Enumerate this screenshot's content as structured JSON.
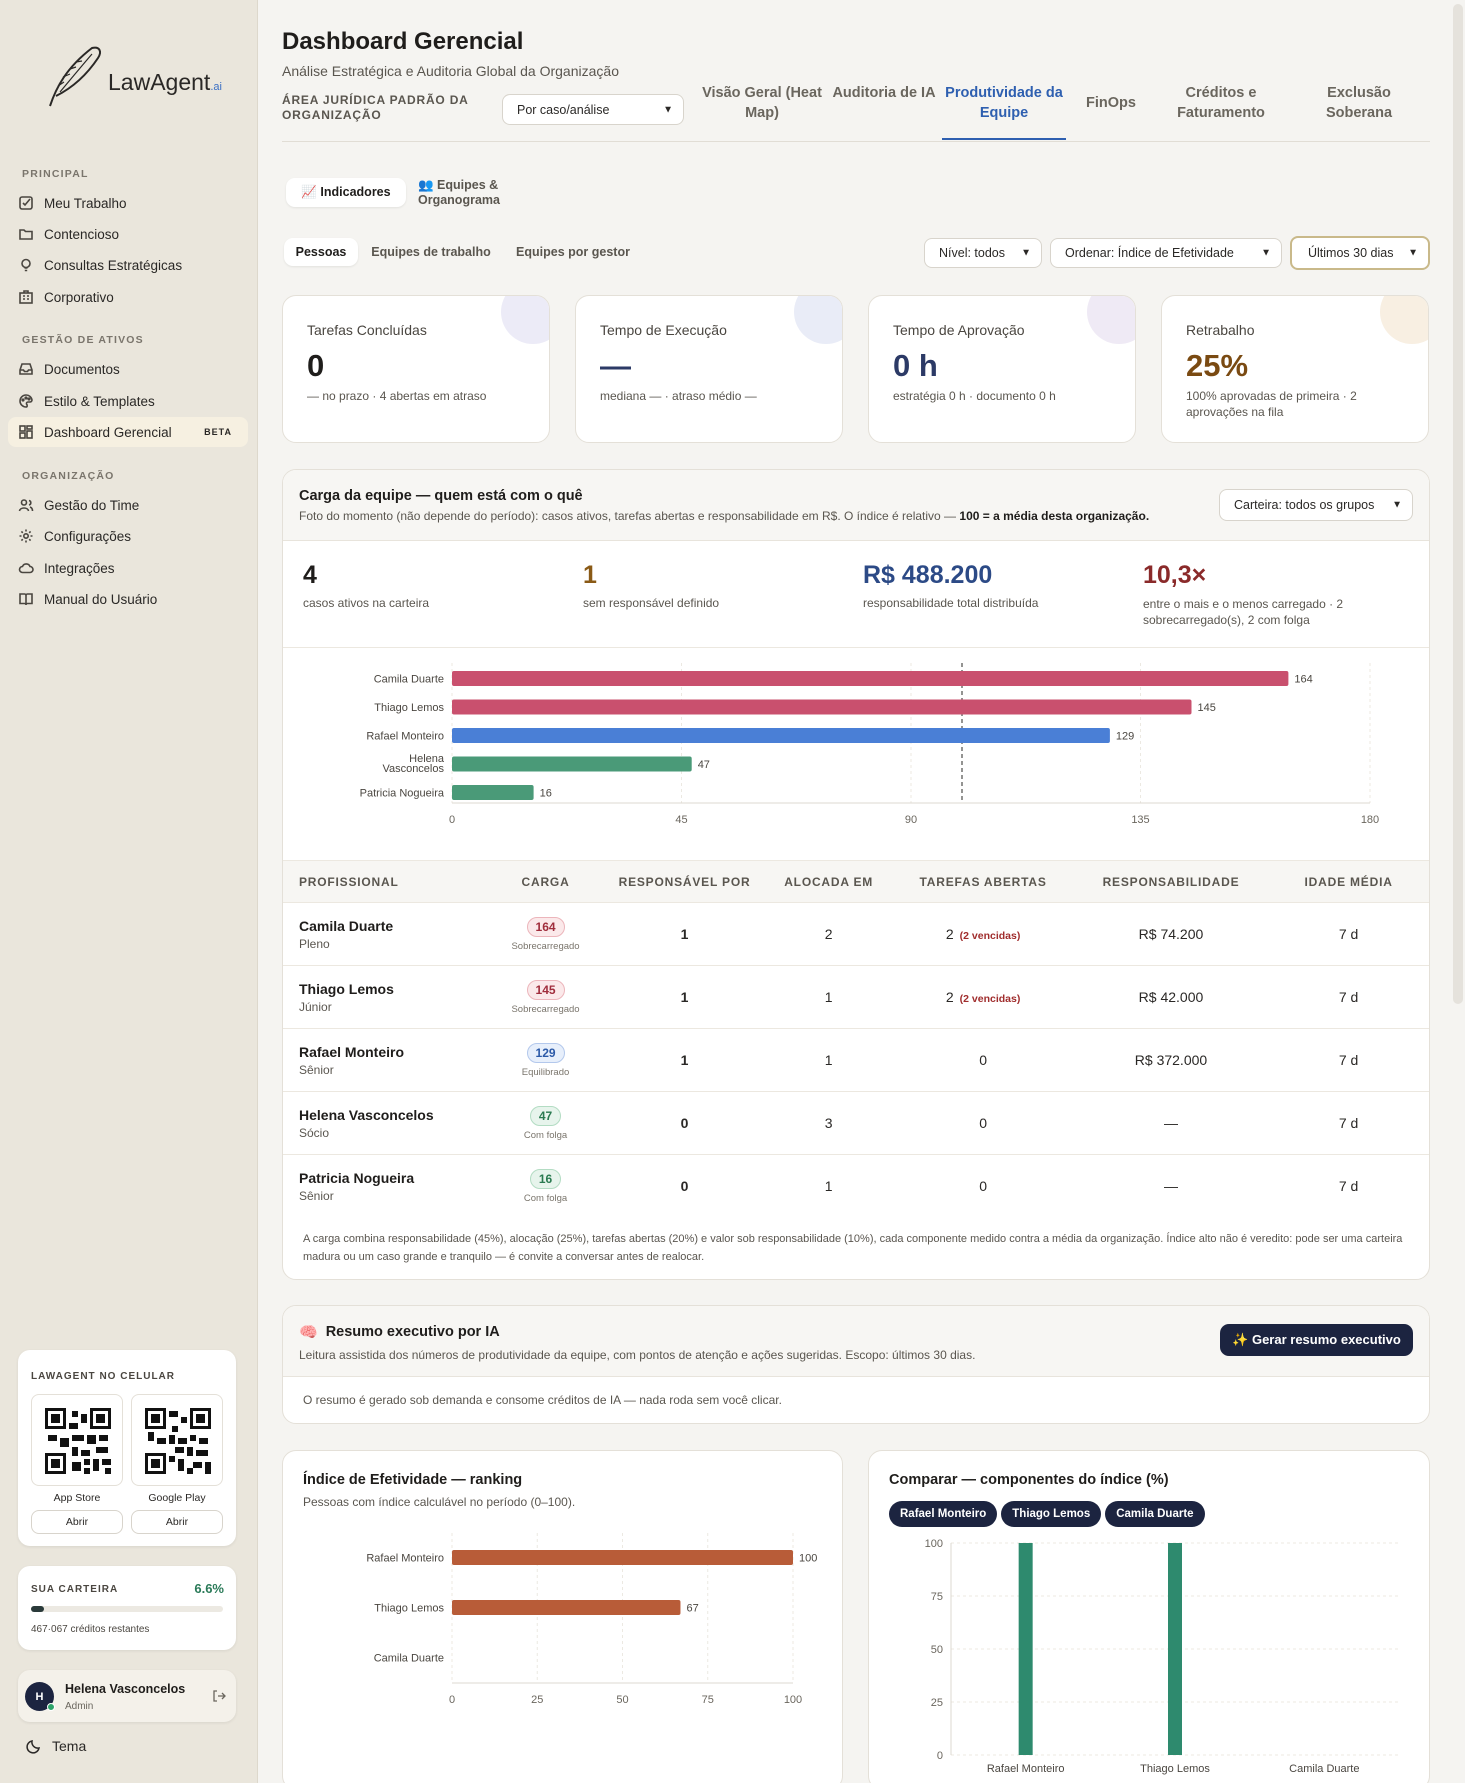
{
  "brand": {
    "name": "LawAgent",
    "suffix": ".ai"
  },
  "sidebar": {
    "sections": [
      {
        "title": "PRINCIPAL",
        "items": [
          {
            "label": "Meu Trabalho",
            "icon": "checkbox-icon"
          },
          {
            "label": "Contencioso",
            "icon": "folder-icon"
          },
          {
            "label": "Consultas Estratégicas",
            "icon": "lightbulb-icon"
          },
          {
            "label": "Corporativo",
            "icon": "building-icon"
          }
        ]
      },
      {
        "title": "GESTÃO DE ATIVOS",
        "items": [
          {
            "label": "Documentos",
            "icon": "inbox-icon"
          },
          {
            "label": "Estilo & Templates",
            "icon": "palette-icon"
          },
          {
            "label": "Dashboard Gerencial",
            "icon": "dashboard-icon",
            "badge": "BETA",
            "active": true
          }
        ]
      },
      {
        "title": "ORGANIZAÇÃO",
        "items": [
          {
            "label": "Gestão do Time",
            "icon": "users-icon"
          },
          {
            "label": "Configurações",
            "icon": "gear-icon"
          },
          {
            "label": "Integrações",
            "icon": "cloud-icon"
          },
          {
            "label": "Manual do Usuário",
            "icon": "book-icon"
          }
        ]
      }
    ],
    "mobile": {
      "title": "LAWAGENT NO CELULAR",
      "stores": [
        {
          "name": "App Store",
          "action": "Abrir"
        },
        {
          "name": "Google Play",
          "action": "Abrir"
        }
      ]
    },
    "wallet": {
      "title": "SUA CARTEIRA",
      "percent": "6.6%",
      "fill": 0.066,
      "credits": "467·067",
      "credits_label": "créditos restantes"
    },
    "user": {
      "initial": "H",
      "name": "Helena Vasconcelos",
      "role": "Admin"
    },
    "theme_label": "Tema"
  },
  "header": {
    "title": "Dashboard Gerencial",
    "subtitle": "Análise Estratégica e Auditoria Global da Organização",
    "area_label": "ÁREA JURÍDICA PADRÃO DA ORGANIZAÇÃO",
    "area_select": "Por caso/análise",
    "tabs": [
      {
        "label": "Visão Geral (Heat Map)"
      },
      {
        "label": "Auditoria de IA"
      },
      {
        "label": "Produtividade da Equipe",
        "active": true
      },
      {
        "label": "FinOps"
      },
      {
        "label": "Créditos e Faturamento"
      },
      {
        "label": "Exclusão Soberana"
      }
    ]
  },
  "subtabs": [
    {
      "label": "📈 Indicadores",
      "active": true
    },
    {
      "label": "👥 Equipes & Organograma"
    }
  ],
  "filters": {
    "groups": [
      {
        "label": "Pessoas",
        "active": true
      },
      {
        "label": "Equipes de trabalho"
      },
      {
        "label": "Equipes por gestor"
      }
    ],
    "level": "Nível: todos",
    "order": "Ordenar: Índice de Efetividade",
    "period": "Últimos 30 dias"
  },
  "kpis": [
    {
      "title": "Tarefas Concluídas",
      "value": "0",
      "detail": "— no prazo · 4 abertas em atraso",
      "color": "#1f1d1b",
      "circle": "#ecebf7"
    },
    {
      "title": "Tempo de Execução",
      "value": "—",
      "detail": "mediana — · atraso médio —",
      "color": "#2c3a66",
      "circle": "#e9ecf7"
    },
    {
      "title": "Tempo de Aprovação",
      "value": "0 h",
      "detail": "estratégia 0 h · documento 0 h",
      "color": "#2c3a66",
      "circle": "#efeaf5"
    },
    {
      "title": "Retrabalho",
      "value": "25%",
      "detail": "100% aprovadas de primeira · 2 aprovações na fila",
      "color": "#7a4a12",
      "circle": "#f8efe2"
    }
  ],
  "load": {
    "title": "Carga da equipe — quem está com o quê",
    "desc": "Foto do momento (não depende do período): casos ativos, tarefas abertas e responsabilidade em R$. O índice é relativo —",
    "desc_bold": "100 = a média desta organização.",
    "wallet_select": "Carteira: todos os grupos",
    "stats": [
      {
        "value": "4",
        "label": "casos ativos na carteira",
        "color": "#1f1d1b"
      },
      {
        "value": "1",
        "label": "sem responsável definido",
        "color": "#8a5a16"
      },
      {
        "value": "R$ 488.200",
        "label": "responsabilidade total distribuída",
        "color": "#2c4a86"
      },
      {
        "value": "10,3×",
        "label": "entre o mais e o menos carregado · 2 sobrecarregado(s), 2 com folga",
        "color": "#8a2a2a"
      }
    ],
    "table": {
      "headers": [
        "PROFISSIONAL",
        "CARGA",
        "RESPONSÁVEL POR",
        "ALOCADA EM",
        "TAREFAS ABERTAS",
        "RESPONSABILIDADE",
        "IDADE MÉDIA"
      ],
      "rows": [
        {
          "name": "Camila Duarte",
          "level": "Pleno",
          "load": "164",
          "status": "Sobrecarregado",
          "resp": "1",
          "alloc": "2",
          "tasks": "2",
          "overdue": "(2 vencidas)",
          "liability": "R$ 74.200",
          "age": "7 d",
          "tone": "red"
        },
        {
          "name": "Thiago Lemos",
          "level": "Júnior",
          "load": "145",
          "status": "Sobrecarregado",
          "resp": "1",
          "alloc": "1",
          "tasks": "2",
          "overdue": "(2 vencidas)",
          "liability": "R$ 42.000",
          "age": "7 d",
          "tone": "red"
        },
        {
          "name": "Rafael Monteiro",
          "level": "Sênior",
          "load": "129",
          "status": "Equilibrado",
          "resp": "1",
          "alloc": "1",
          "tasks": "0",
          "overdue": "",
          "liability": "R$ 372.000",
          "age": "7 d",
          "tone": "blue"
        },
        {
          "name": "Helena Vasconcelos",
          "level": "Sócio",
          "load": "47",
          "status": "Com folga",
          "resp": "0",
          "alloc": "3",
          "tasks": "0",
          "overdue": "",
          "liability": "—",
          "age": "7 d",
          "tone": "green"
        },
        {
          "name": "Patricia Nogueira",
          "level": "Sênior",
          "load": "16",
          "status": "Com folga",
          "resp": "0",
          "alloc": "1",
          "tasks": "0",
          "overdue": "",
          "liability": "—",
          "age": "7 d",
          "tone": "green"
        }
      ]
    },
    "footnote": "A carga combina responsabilidade (45%), alocação (25%), tarefas abertas (20%) e valor sob responsabilidade (10%), cada componente medido contra a média da organização. Índice alto não é veredito: pode ser uma carteira madura ou um caso grande e tranquilo — é convite a conversar antes de realocar."
  },
  "ai_summary": {
    "title": "Resumo executivo por IA",
    "desc": "Leitura assistida dos números de produtividade da equipe, com pontos de atenção e ações sugeridas. Escopo: últimos 30 dias.",
    "button": "✨ Gerar resumo executivo",
    "note": "O resumo é gerado sob demanda e consome créditos de IA — nada roda sem você clicar."
  },
  "ranking": {
    "title": "Índice de Efetividade — ranking",
    "subtitle": "Pessoas com índice calculável no período (0–100)."
  },
  "compare": {
    "title": "Comparar — componentes do índice (%)",
    "chips": [
      "Rafael Monteiro",
      "Thiago Lemos",
      "Camila Duarte"
    ]
  },
  "chart_data": [
    {
      "type": "bar",
      "orientation": "horizontal",
      "categories": [
        "Camila Duarte",
        "Thiago Lemos",
        "Rafael Monteiro",
        "Helena Vasconcelos",
        "Patricia Nogueira"
      ],
      "values": [
        164,
        145,
        129,
        47,
        16
      ],
      "colors": [
        "#c9506e",
        "#c9506e",
        "#4a7fd6",
        "#4a9a78",
        "#4a9a78"
      ],
      "xlim": [
        0,
        180
      ],
      "xticks": [
        0,
        45,
        90,
        135,
        180
      ],
      "reference_line": 100,
      "grid": true
    },
    {
      "type": "bar",
      "orientation": "horizontal",
      "categories": [
        "Rafael Monteiro",
        "Thiago Lemos",
        "Camila Duarte"
      ],
      "values": [
        100,
        67,
        null
      ],
      "color": "#b85c38",
      "xlim": [
        0,
        100
      ],
      "xticks": [
        0,
        25,
        50,
        75,
        100
      ],
      "grid": true
    },
    {
      "type": "bar",
      "categories": [
        "Rafael Monteiro",
        "Thiago Lemos",
        "Camila Duarte"
      ],
      "values": [
        100,
        100,
        0
      ],
      "color": "#2e8a6e",
      "ylim": [
        0,
        100
      ],
      "yticks": [
        0,
        25,
        50,
        75,
        100
      ],
      "grid": true
    }
  ]
}
